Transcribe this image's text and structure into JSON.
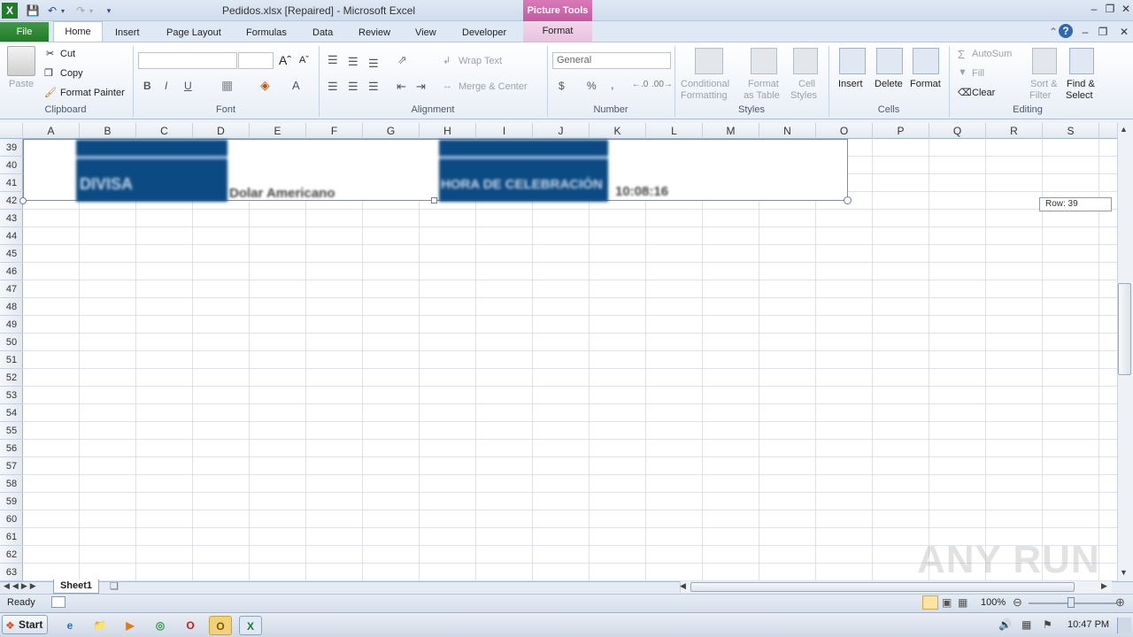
{
  "window": {
    "title": "Pedidos.xlsx [Repaired]  -  Microsoft Excel",
    "context_band": "Picture Tools"
  },
  "tabs": {
    "file": "File",
    "home": "Home",
    "insert": "Insert",
    "page_layout": "Page Layout",
    "formulas": "Formulas",
    "data": "Data",
    "review": "Review",
    "view": "View",
    "developer": "Developer",
    "format": "Format"
  },
  "ribbon": {
    "clipboard": {
      "paste": "Paste",
      "cut": "Cut",
      "copy": "Copy",
      "format_painter": "Format Painter",
      "label": "Clipboard"
    },
    "font": {
      "label": "Font",
      "bold": "B",
      "italic": "I",
      "underline": "U"
    },
    "alignment": {
      "wrap_text": "Wrap Text",
      "merge_center": "Merge & Center",
      "label": "Alignment"
    },
    "number": {
      "format_value": "General",
      "currency": "$",
      "percent": "%",
      "comma": ",",
      "label": "Number"
    },
    "styles": {
      "conditional_1": "Conditional",
      "conditional_2": "Formatting",
      "format_table_1": "Format",
      "format_table_2": "as Table",
      "cell_styles_1": "Cell",
      "cell_styles_2": "Styles",
      "label": "Styles"
    },
    "cells": {
      "insert": "Insert",
      "delete": "Delete",
      "format": "Format",
      "label": "Cells"
    },
    "editing": {
      "autosum": "AutoSum",
      "fill": "Fill",
      "clear": "Clear",
      "sort_1": "Sort &",
      "sort_2": "Filter",
      "find_1": "Find &",
      "find_2": "Select",
      "label": "Editing"
    }
  },
  "grid": {
    "columns": [
      "A",
      "B",
      "C",
      "D",
      "E",
      "F",
      "G",
      "H",
      "I",
      "J",
      "K",
      "L",
      "M",
      "N",
      "O",
      "P",
      "Q",
      "R",
      "S"
    ],
    "rows": [
      "39",
      "40",
      "41",
      "42",
      "43",
      "44",
      "45",
      "46",
      "47",
      "48",
      "49",
      "50",
      "51",
      "52",
      "53",
      "54",
      "55",
      "56",
      "57",
      "58",
      "59",
      "60",
      "61",
      "62",
      "63"
    ]
  },
  "picture": {
    "text_left": "DIVISA",
    "text_left_sub": "Dolar Americano",
    "text_right": "HORA DE CELEBRACIÓN",
    "text_right_sub": "10:08:16"
  },
  "tooltip": "Row: 39",
  "sheets": {
    "active": "Sheet1"
  },
  "status": {
    "ready": "Ready",
    "zoom": "100%"
  },
  "taskbar": {
    "start": "Start",
    "clock": "10:47 PM"
  },
  "watermark": "ANY RUN",
  "colors": {
    "excel_green": "#217a2a",
    "picture_blue": "#0b4a82",
    "context_pink": "#c45aa0"
  }
}
